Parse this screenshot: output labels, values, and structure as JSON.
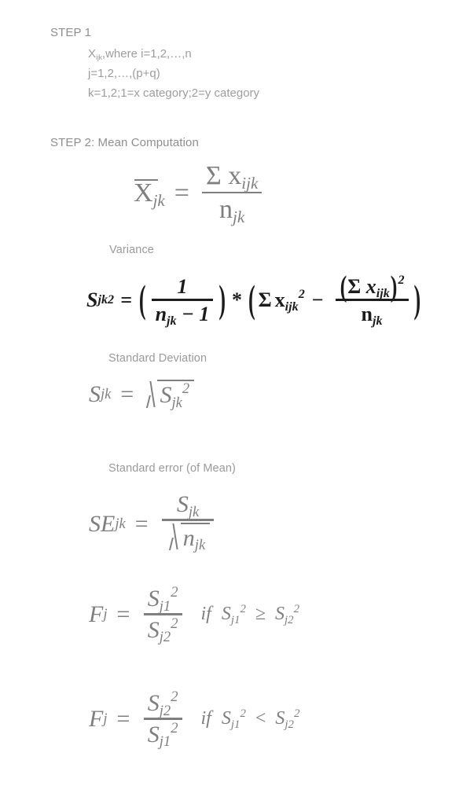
{
  "document": {
    "background_color": "#ffffff",
    "text_color_muted": "#8e8e8e",
    "text_color_dark": "#1c1c1c"
  },
  "step1": {
    "heading": "STEP 1",
    "variable": "X",
    "variable_subscript": "ijk",
    "line1_rest": ",where i=1,2,…,n",
    "line2": "j=1,2,…,(p+q)",
    "line3": "k=1,2;1=x category;2=y category"
  },
  "step2": {
    "heading": "STEP 2:   Mean Computation",
    "mean": {
      "lhs": "X",
      "lhs_sub": "jk",
      "eq": "=",
      "numerator_sigma": "Σ",
      "numerator_var": "x",
      "numerator_sub": "ijk",
      "denominator": "n",
      "denominator_sub": "jk"
    },
    "variance": {
      "label": "Variance",
      "lhs": "S",
      "lhs_sub": "jk",
      "lhs_sup": "2",
      "eq": "=",
      "open_paren": "(",
      "frac1_num": "1",
      "frac1_den_n": "n",
      "frac1_den_sub": "jk",
      "frac1_den_rest": "− 1",
      "close_paren1": ")",
      "times": "*",
      "open_paren2": "(",
      "sum_sigma": "Σ",
      "sum_var": "x",
      "sum_sub": "ijk",
      "sum_sup": "2",
      "minus": "−",
      "frac2_num_open": "(",
      "frac2_num_sigma": "Σ",
      "frac2_num_var": "x",
      "frac2_num_sub": "ijk",
      "frac2_num_close": ")",
      "frac2_num_sup": "2",
      "frac2_den": "n",
      "frac2_den_sub": "jk",
      "close_paren2": ")"
    },
    "stdev": {
      "label": "Standard Deviation",
      "lhs": "S",
      "lhs_sub": "jk",
      "eq": "=",
      "radicand": "S",
      "radicand_sub": "jk",
      "radicand_sup": "2"
    },
    "stderr": {
      "label": "Standard error (of Mean)",
      "lhs": "SE",
      "lhs_sub": "jk",
      "eq": "=",
      "num": "S",
      "num_sub": "jk",
      "den": "n",
      "den_sub": "jk"
    },
    "fratio1": {
      "lhs": "F",
      "lhs_sub": "j",
      "eq": "=",
      "num": "S",
      "num_sub": "j1",
      "num_sup": "2",
      "den": "S",
      "den_sub": "j2",
      "den_sup": "2",
      "cond_if": "if",
      "cond_left": "S",
      "cond_left_sub": "j1",
      "cond_left_sup": "2",
      "cond_op": "≥",
      "cond_right": "S",
      "cond_right_sub": "j2",
      "cond_right_sup": "2"
    },
    "fratio2": {
      "lhs": "F",
      "lhs_sub": "j",
      "eq": "=",
      "num": "S",
      "num_sub": "j2",
      "num_sup": "2",
      "den": "S",
      "den_sub": "j1",
      "den_sup": "2",
      "cond_if": "if",
      "cond_left": "S",
      "cond_left_sub": "j1",
      "cond_left_sup": "2",
      "cond_op": "<",
      "cond_right": "S",
      "cond_right_sub": "j2",
      "cond_right_sup": "2"
    }
  }
}
